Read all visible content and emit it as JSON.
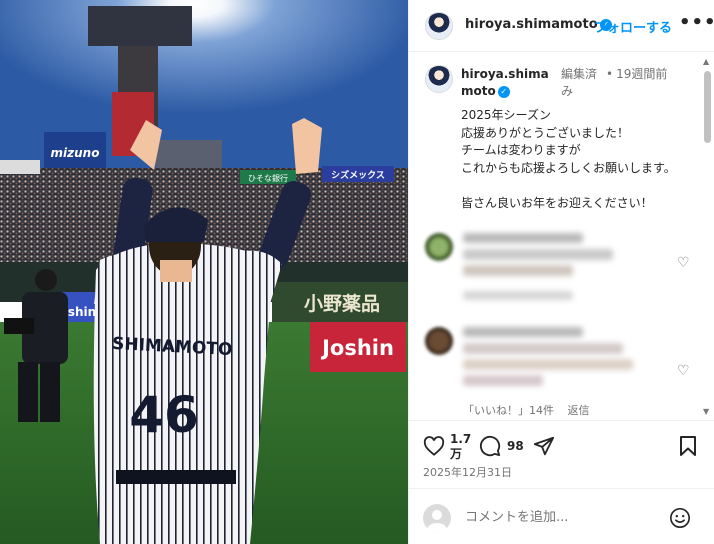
{
  "post": {
    "username": "hiroya.shimamoto",
    "follow_label": "フォローする",
    "more_label": "•••",
    "edited_label": "編集済み",
    "time_label": "19週間前",
    "caption": "2025年シーズン\n応援ありがとうございました！\nチームは変わりますが\nこれからも応援よろしくお願いします。\n\n皆さん良いお年をお迎えください！",
    "likes_count": "1.7万",
    "comments_count": "98",
    "date": "2025年12月31日",
    "comment_placeholder": "コメントを追加..."
  },
  "comments": {
    "replies_label": "「いいね！」14件",
    "reply_label": "返信"
  },
  "photo": {
    "jersey_name": "SHIMAMOTO",
    "jersey_number": "46",
    "sponsor_mizuno": "mizuno",
    "sponsor_joshin": "Joshin",
    "banner_kanji": "小野薬品",
    "banner_ads": "シズメックス",
    "banner_left": "ひそな銀行",
    "banner_ishi": "shin"
  },
  "colors": {
    "accent": "#0095f6",
    "sky": "#3f6fb8",
    "field": "#2f6a2c",
    "joshin_red": "#c8243a"
  }
}
